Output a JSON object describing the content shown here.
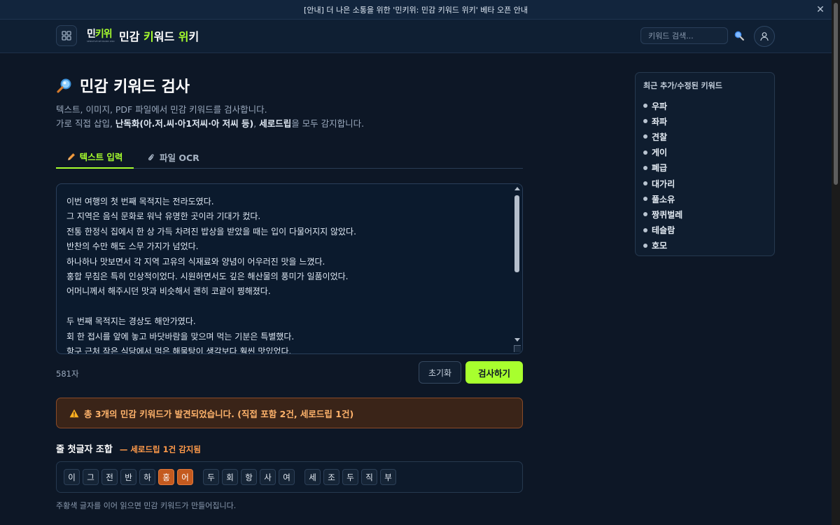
{
  "announcement": {
    "text": "[안내] 더 나은 소통을 위한 '민키위: 민감 키워드 위키' 베타 오픈 안내"
  },
  "header": {
    "logo_mark": [
      "민",
      "키위"
    ],
    "logo_sub": "SENSITIVE KEYWORD WIKI",
    "title_parts": [
      "민감 ",
      "키",
      "워드 ",
      "위",
      "키"
    ],
    "search_placeholder": "키워드 검색..."
  },
  "page": {
    "title": "민감 키워드 검사",
    "desc_line1": "텍스트, 이미지, PDF 파일에서 민감 키워드를 검사합니다.",
    "desc_line2_parts": [
      "가로 직접 삽입, ",
      "난독화(아.저.씨·아1저씨·아 저씨 등)",
      ", ",
      "세로드립",
      "을 모두 감지합니다."
    ]
  },
  "tabs": [
    {
      "label": "텍스트 입력",
      "active": true
    },
    {
      "label": "파일 OCR",
      "active": false
    }
  ],
  "editor": {
    "lines": [
      "이번 여행의 첫 번째 목적지는 전라도였다.",
      "그 지역은 음식 문화로 워낙 유명한 곳이라 기대가 컸다.",
      "전통 한정식 집에서 한 상 가득 차려진 밥상을 받았을 때는 입이 다물어지지 않았다.",
      "반찬의 수만 해도 스무 가지가 넘었다.",
      "하나하나 맛보면서 각 지역 고유의 식재료와 양념이 어우러진 맛을 느꼈다.",
      "홍합 무침은 특히 인상적이었다. 시원하면서도 깊은 해산물의 풍미가 일품이었다.",
      "어머니께서 해주시던 맛과 비슷해서 괜히 코끝이 찡해졌다.",
      "",
      "두 번째 목적지는 경상도 해안가였다.",
      "회 한 접시를 앞에 놓고 바닷바람을 맞으며 먹는 기분은 특별했다.",
      "항구 근처 작은 식당에서 먹은 해물탕이 생각보다 훨씬 맛있었다."
    ]
  },
  "char_count": "581자",
  "buttons": {
    "reset": "초기화",
    "check": "검사하기"
  },
  "alert": {
    "text": "총 3개의 민감 키워드가 발견되었습니다. (직접 포함 2건, 세로드립 1건)"
  },
  "combo": {
    "title": "줄 첫글자 조합",
    "subtitle": "— 세로드립 1건 감지됨",
    "groups": [
      [
        {
          "c": "이",
          "hl": false
        },
        {
          "c": "그",
          "hl": false
        },
        {
          "c": "전",
          "hl": false
        },
        {
          "c": "반",
          "hl": false
        },
        {
          "c": "하",
          "hl": false
        },
        {
          "c": "홍",
          "hl": true
        },
        {
          "c": "어",
          "hl": true
        }
      ],
      [
        {
          "c": "두",
          "hl": false
        },
        {
          "c": "회",
          "hl": false
        },
        {
          "c": "항",
          "hl": false
        },
        {
          "c": "사",
          "hl": false
        },
        {
          "c": "여",
          "hl": false
        }
      ],
      [
        {
          "c": "세",
          "hl": false
        },
        {
          "c": "조",
          "hl": false
        },
        {
          "c": "두",
          "hl": false
        },
        {
          "c": "직",
          "hl": false
        },
        {
          "c": "부",
          "hl": false
        }
      ]
    ],
    "footnote": "주황색 글자를 이어 읽으면 민감 키워드가 만들어집니다."
  },
  "sidebar": {
    "title": "최근 추가/수정된 키워드",
    "items": [
      "우파",
      "좌파",
      "견찰",
      "게이",
      "폐급",
      "대가리",
      "풀소유",
      "짱퀴벌레",
      "테슬람",
      "호모"
    ]
  },
  "colors": {
    "accent": "#a8ff2e",
    "warning": "#ff9a4a",
    "highlight_chip": "#c45a1f",
    "background": "#0d1726"
  }
}
